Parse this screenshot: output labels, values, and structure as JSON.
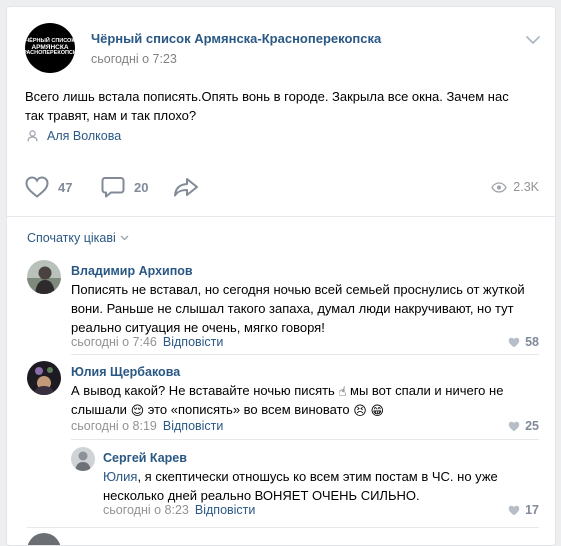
{
  "post": {
    "group_name": "Чёрный список Армянска-Красноперекопска",
    "avatar_text": [
      "ЧЁРНЫЙ СПИСОК",
      "АРМЯНСКА",
      "КРАСНОПЕРЕКОПСКА"
    ],
    "time": "сьогодні о 7:23",
    "text": "Всего лишь встала пописять.Опять вонь в городе. Закрыла все окна. Зачем нас так травят, нам и так плохо?",
    "signer": "Аля Волкова",
    "likes": "47",
    "comments": "20",
    "views": "2.3K"
  },
  "comments_section": {
    "sort_label": "Спочатку цікаві"
  },
  "comments": [
    {
      "author": "Владимир Архипов",
      "text": "Пописять не вставал, но сегодня ночью всей семьей проснулись от жуткой вони. Раньше не слышал такого запаха, думал люди накручивают, но тут реально ситуация не очень, мягко говоря!",
      "time": "сьогодні о 7:46",
      "reply_label": "Відповісти",
      "likes": "58"
    },
    {
      "author": "Юлия Щербакова",
      "text_part1": "А вывод какой? Не вставайте ночью писять",
      "text_part2": "мы вот спали и ничего не слышали",
      "text_part3": "это «пописять» во всем виновато",
      "time": "сьогодні о 8:19",
      "reply_label": "Відповісти",
      "likes": "25"
    },
    {
      "author": "Сергей Карев",
      "quoted_name": "Юлия",
      "text": ", я скептически отношусь ко всем этим постам в ЧС. но уже несколько дней реально ВОНЯЕТ ОЧЕНЬ СИЛЬНО.",
      "time": "сьогодні о 8:23",
      "reply_label": "Відповісти",
      "likes": "17"
    }
  ],
  "colors": {
    "link": "#2a5885",
    "meta": "#939393",
    "icon": "#828a99",
    "background": "#edeef0"
  },
  "icons": [
    "chevron-down-icon",
    "user-icon",
    "heart-icon",
    "comment-icon",
    "share-icon",
    "eye-icon"
  ]
}
